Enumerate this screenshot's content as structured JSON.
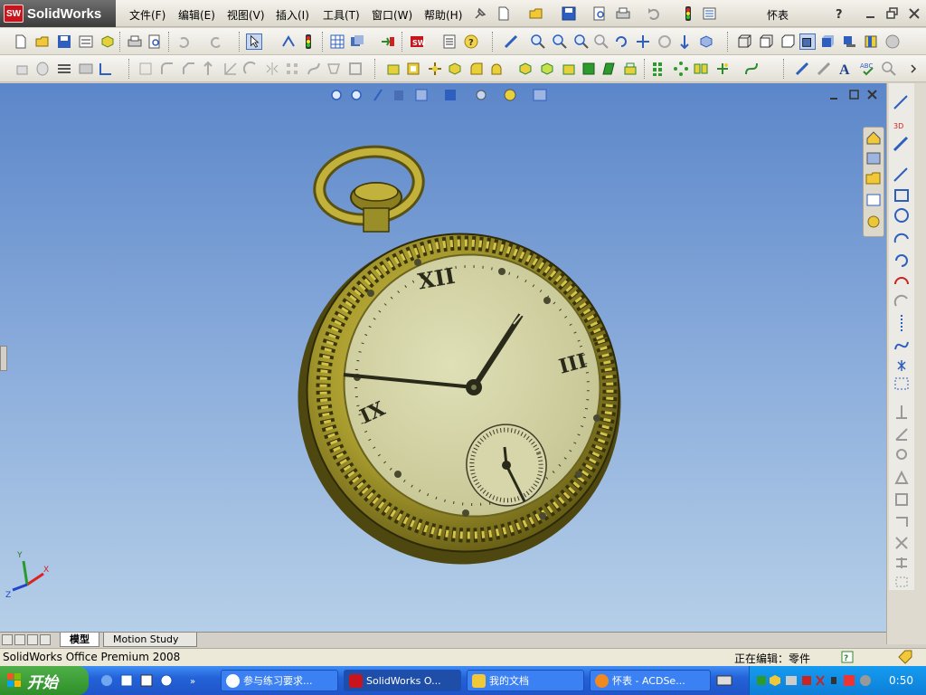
{
  "app": {
    "name": "SolidWorks",
    "logo_mark": "SW",
    "document_title": "怀表"
  },
  "menu": [
    "文件(F)",
    "编辑(E)",
    "视图(V)",
    "插入(I)",
    "工具(T)",
    "窗口(W)",
    "帮助(H)"
  ],
  "tabs": {
    "model": "模型",
    "motion": "Motion Study 1"
  },
  "status": {
    "product": "SolidWorks Office Premium 2008",
    "editing": "正在编辑：零件"
  },
  "triad": {
    "x": "X",
    "y": "Y",
    "z": "Z"
  },
  "watch": {
    "numeral_12": "XII",
    "numeral_3": "III",
    "numeral_9": "IX"
  },
  "taskbar": {
    "start": "开始",
    "tasks": [
      "参与练习要求...",
      "SolidWorks O...",
      "我的文档",
      "怀表 - ACDSe..."
    ],
    "clock": "0:50"
  },
  "colors": {
    "viewport_top": "#5b86c9",
    "viewport_bottom": "#b6cfe8",
    "watch_gold": "#a89b2e",
    "dial": "#d3d3a6",
    "taskbar": "#2462d9",
    "start_green": "#3a9b35"
  }
}
